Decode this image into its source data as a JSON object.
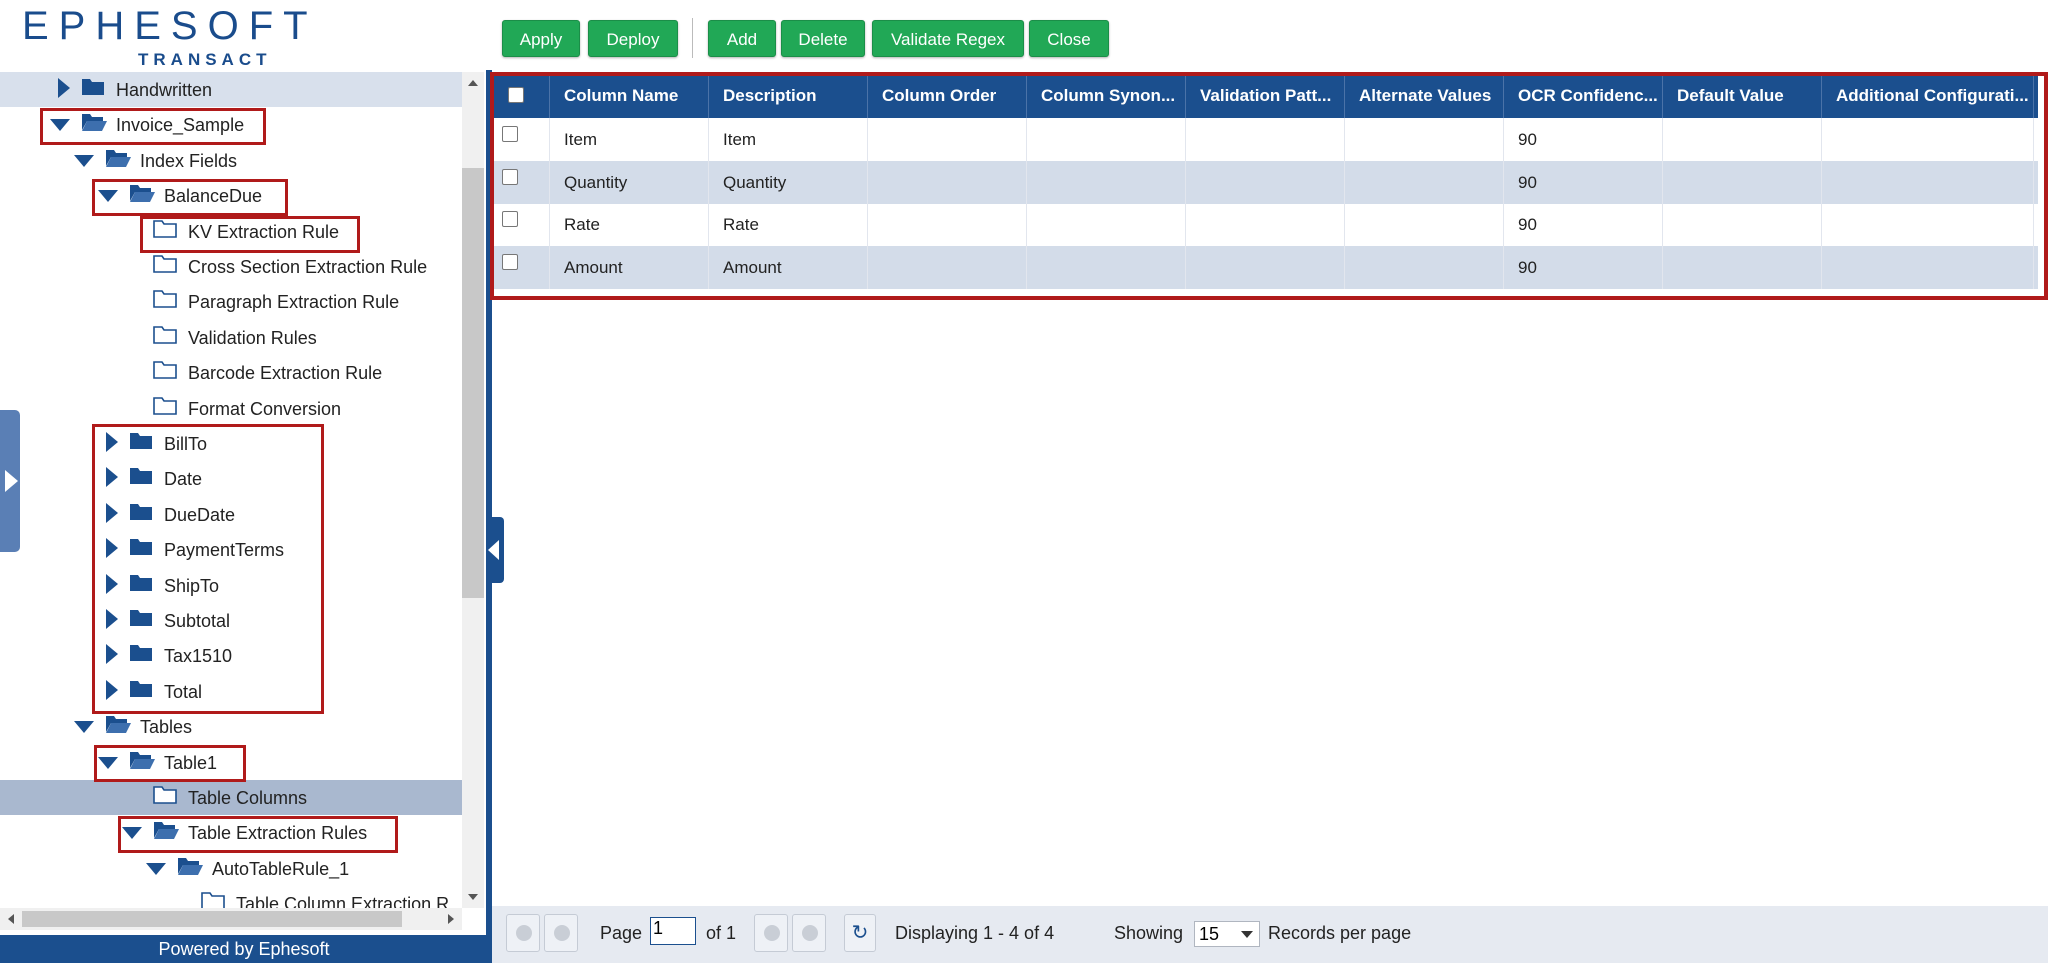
{
  "logo": {
    "brand": "EPHESOFT",
    "product": "TRANSACT"
  },
  "toolbar": {
    "apply": "Apply",
    "deploy": "Deploy",
    "add": "Add",
    "delete": "Delete",
    "validate_regex": "Validate Regex",
    "close": "Close"
  },
  "tree": {
    "nodes": [
      {
        "label": "Handwritten"
      },
      {
        "label": "Invoice_Sample"
      },
      {
        "label": "Index Fields"
      },
      {
        "label": "BalanceDue"
      },
      {
        "label": "KV Extraction Rule"
      },
      {
        "label": "Cross Section Extraction Rule"
      },
      {
        "label": "Paragraph Extraction Rule"
      },
      {
        "label": "Validation Rules"
      },
      {
        "label": "Barcode Extraction Rule"
      },
      {
        "label": "Format Conversion"
      },
      {
        "label": "BillTo"
      },
      {
        "label": "Date"
      },
      {
        "label": "DueDate"
      },
      {
        "label": "PaymentTerms"
      },
      {
        "label": "ShipTo"
      },
      {
        "label": "Subtotal"
      },
      {
        "label": "Tax1510"
      },
      {
        "label": "Total"
      },
      {
        "label": "Tables"
      },
      {
        "label": "Table1"
      },
      {
        "label": "Table Columns"
      },
      {
        "label": "Table Extraction Rules"
      },
      {
        "label": "AutoTableRule_1"
      },
      {
        "label": "Table Column Extraction R"
      }
    ]
  },
  "footer": {
    "powered": "Powered by Ephesoft"
  },
  "grid": {
    "columns": [
      "Column Name",
      "Description",
      "Column Order",
      "Column Synon...",
      "Validation Patt...",
      "Alternate Values",
      "OCR Confidenc...",
      "Default Value",
      "Additional Configurati..."
    ],
    "rows": [
      {
        "name": "Item",
        "description": "Item",
        "order": "",
        "synonyms": "",
        "validation": "",
        "alternate": "",
        "ocr": "90",
        "default": "",
        "additional": ""
      },
      {
        "name": "Quantity",
        "description": "Quantity",
        "order": "",
        "synonyms": "",
        "validation": "",
        "alternate": "",
        "ocr": "90",
        "default": "",
        "additional": ""
      },
      {
        "name": "Rate",
        "description": "Rate",
        "order": "",
        "synonyms": "",
        "validation": "",
        "alternate": "",
        "ocr": "90",
        "default": "",
        "additional": ""
      },
      {
        "name": "Amount",
        "description": "Amount",
        "order": "",
        "synonyms": "",
        "validation": "",
        "alternate": "",
        "ocr": "90",
        "default": "",
        "additional": ""
      }
    ]
  },
  "paging": {
    "page_label": "Page",
    "page_value": "1",
    "of_label": "of 1",
    "displaying": "Displaying 1 - 4 of 4",
    "showing_label": "Showing",
    "per_page_value": "15",
    "records_label": "Records per page"
  },
  "colors": {
    "accent": "#1b4f8e",
    "button": "#21a856",
    "highlight_box": "#b01a1a"
  }
}
